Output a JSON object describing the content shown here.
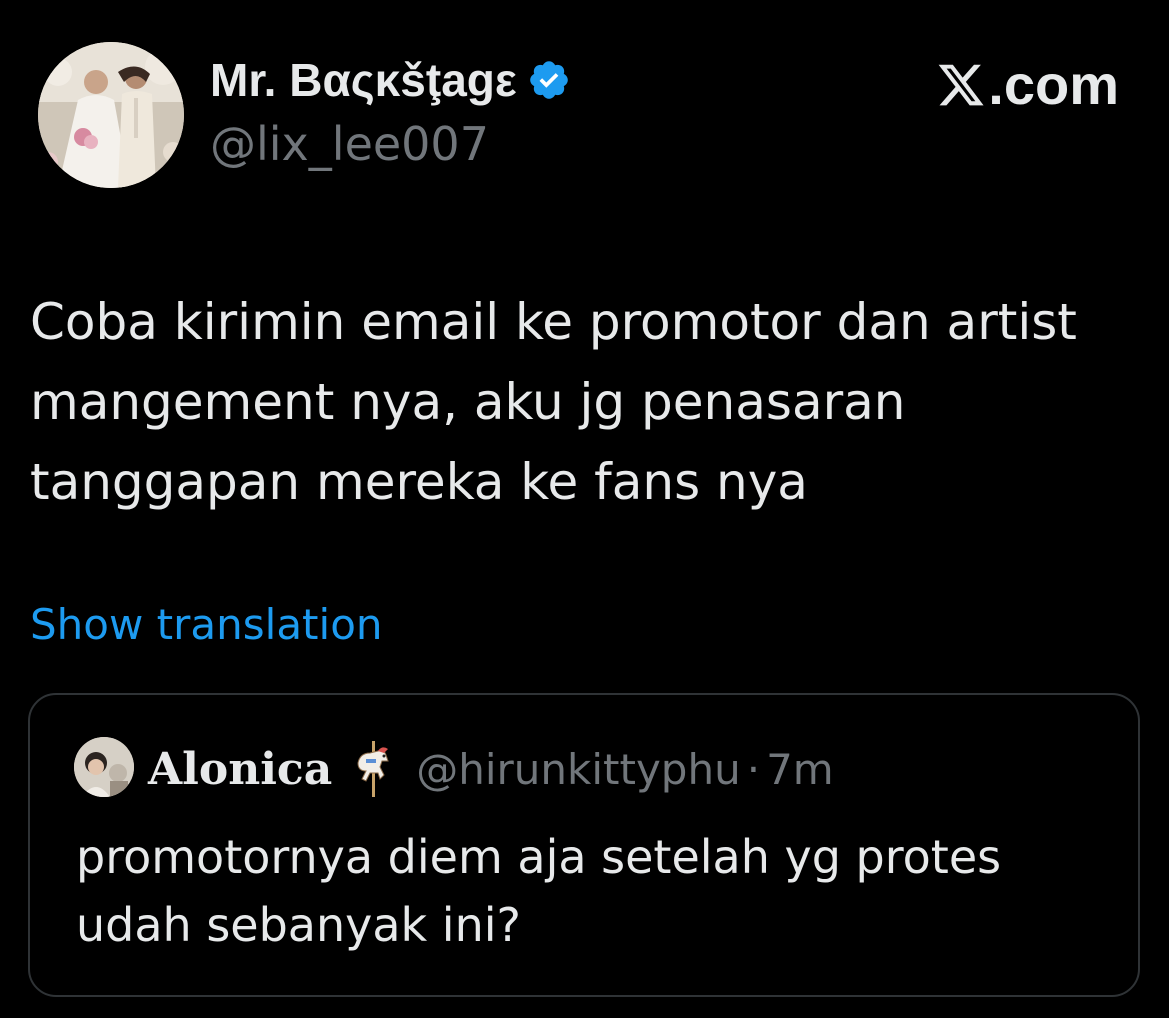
{
  "author": {
    "name": "Mr. Βαςκšţagε",
    "handle": "@lix_lee007",
    "verified": true,
    "avatar_icon": "wedding-couple-avatar"
  },
  "brand": {
    "logo_icon": "x-logo-icon",
    "label": ".com"
  },
  "post": {
    "lines": [
      "Coba kirimin email ke promotor dan artist",
      "mangement nya, aku jg penasaran",
      "tanggapan mereka ke fans nya"
    ]
  },
  "translate_link": "Show translation",
  "quoted_post": {
    "author_name": "Alonica",
    "name_emoji_icon": "carousel-horse-icon",
    "handle": "@hirunkittyphu",
    "separator": "·",
    "time": "7m",
    "lines": [
      "promotornya diem aja setelah yg protes",
      "udah sebanyak ini?"
    ]
  },
  "colors": {
    "background": "#000000",
    "text_primary": "#e7e9ea",
    "text_secondary": "#71767b",
    "link": "#1d9bf0",
    "verified_badge": "#1d9bf0",
    "border": "#2f3336"
  }
}
